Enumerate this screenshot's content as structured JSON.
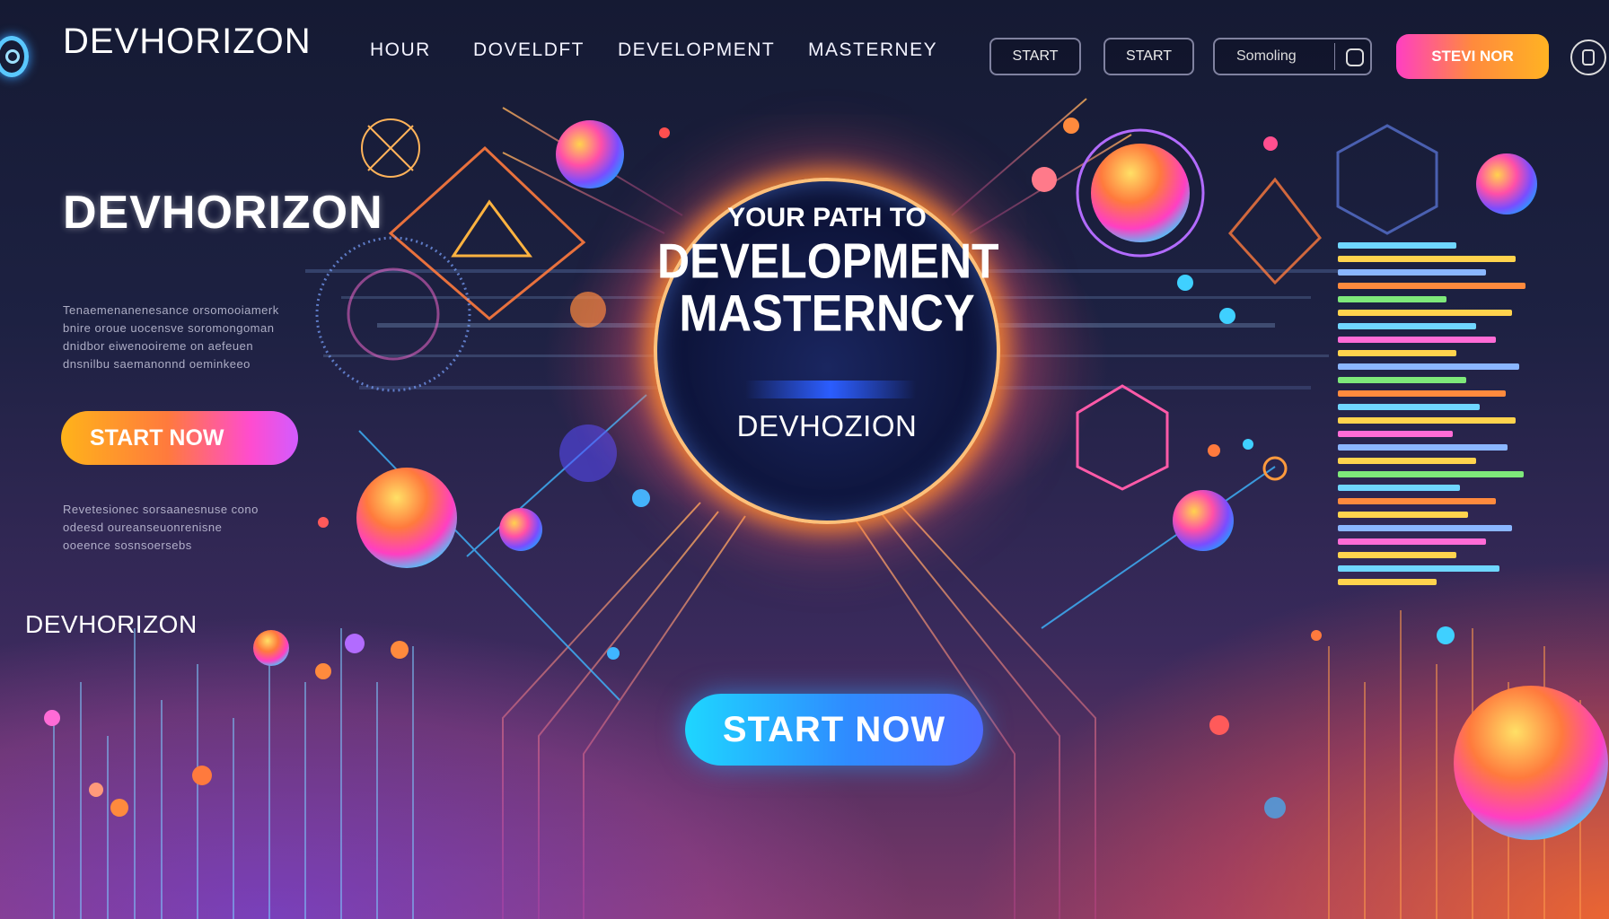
{
  "nav": {
    "brand": "DEVHORIZON",
    "links": [
      "HOUR",
      "DOVELDFT",
      "DEVELOPMENT",
      "MASTERNEY"
    ],
    "btn_start_1": "START",
    "btn_start_2": "START",
    "search_placeholder": "Somoling",
    "cta": "STEVI NOR"
  },
  "hero": {
    "brand": "DEVHORIZON",
    "blurb_1": [
      "Tenaemenanenesance orsomooiamerk",
      "bnire oroue uocensve soromongoman",
      "dnidbor eiwenooireme on aefeuen",
      "dnsnilbu saemanonnd oeminkeeo"
    ],
    "start_left": "START NOW",
    "blurb_2": [
      "Revetesionec sorsaanesnuse cono",
      "odeesd oureanseuonrenisne",
      "ooeence sosnsoersebs"
    ],
    "small_brand": "DEVHORIZON"
  },
  "center": {
    "line1": "YOUR PATH TO",
    "line2": "DEVELOPMENT",
    "line3": "MASTERNCY",
    "brand": "DEVHOZION",
    "start": "START NOW"
  },
  "colors": {
    "accent_cyan": "#2f8bff",
    "accent_pink": "#ff3fc2",
    "accent_orange": "#ff8a3d",
    "bg_dark": "#151a33"
  },
  "icons": [
    "logo-icon",
    "search-square-icon",
    "menu-icon"
  ]
}
